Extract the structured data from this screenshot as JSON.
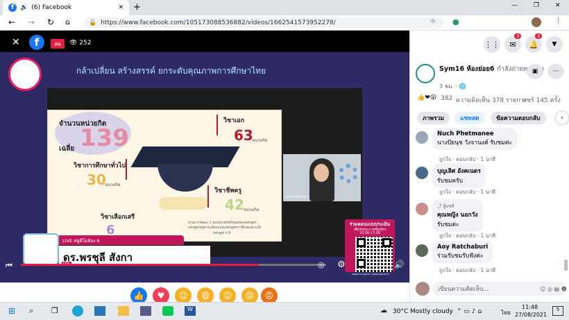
{
  "browser": {
    "tab_title": "(6) Facebook",
    "url": "https://www.facebook.com/105173088536882/videos/1662541573952278/"
  },
  "video": {
    "live_label": "สด",
    "viewer_count": "252",
    "headline": "กล้าเปลี่ยน สร้างสรรค์ ยกระดับคุณภาพการศึกษาไทย",
    "chart": {
      "total_title": "จำนวนหน่วยกิต",
      "avg_label": "เฉลี่ย",
      "total_value": "139",
      "segments": [
        {
          "label": "วิชาเอก",
          "value": "63",
          "unit": "หน่วยกิต"
        },
        {
          "label": "วิชาการศึกษาทั่วไป",
          "value": "30",
          "unit": "หน่วยกิต"
        },
        {
          "label": "วิชาชีพครู",
          "value": "42",
          "unit": "หน่วยกิต"
        },
        {
          "label": "วิชาเลือกเสรี",
          "value": "6",
          "unit": ""
        }
      ],
      "note_line1": "ส่วนมากร้อยละ 5 ของหน่วยกิตทั้งหมดของหลักสูตร",
      "note_line2": "หลักสูตรครูควรเปลี่ยนแปลงหลักสูตรการฝึกสอนตามได้",
      "note_line3": "หลักสูตร 4 ปี"
    },
    "webcam_caption": "ดร.พรชุลี สังกา",
    "lower_third": {
      "top_label": "LIVE สตูดิโอห้อง 6",
      "name": "ดร.พรชุลี สังกา",
      "badge": "LIVE"
    },
    "qr_panel": {
      "title": "ร่วมตอบแบบประเมิน",
      "subtitle": "เพื่อรับประกาศนียบัตร",
      "time": "10.00-17.00",
      "footer": "www.trcs.go.th / www.ksp.or.th"
    },
    "progress_fraction": 0.78
  },
  "post": {
    "page_name": "Sym16 ห้องย่อย6",
    "status": "กำลังถ่ายทอดสด",
    "time": "3 ชม.",
    "reactions_count": "382",
    "comments_count": "ความคิดเห็น 378 รายการ",
    "shares_count": "แชร์ 145 ครั้ง"
  },
  "tabs": [
    "ภาพรวม",
    "แชทสด",
    "ข้อความตอบกลับ"
  ],
  "comments": [
    {
      "name": "Nuch Phetmanee",
      "text": "นางปัยนุช วังจานงค์ รับชมค่ะ",
      "like": "ถูกใจ",
      "reply": "ตอบกลับ",
      "time": "1 นาที",
      "avatar_color": "#9aa7b8"
    },
    {
      "name": "บุญเลิศ อังคเนตร",
      "text": "รับชมครับ",
      "like": "ถูกใจ",
      "reply": "ตอบกลับ",
      "time": "1 นาที",
      "avatar_color": "#4a6a8a"
    },
    {
      "name": "คุณหญิง นอกวัง",
      "text": "รับชมค่ะ",
      "badge": "ผู้แชร์",
      "like": "ถูกใจ",
      "reply": "ตอบกลับ",
      "time": "1 นาที",
      "avatar_color": "#c88f8f"
    },
    {
      "name": "Aoy Ratchaburi",
      "text": "ร่วมรับชมรับฟังค่ะ",
      "like": "ถูกใจ",
      "reply": "ตอบกลับ",
      "time": "1 นาที",
      "avatar_color": "#5a6b5a"
    }
  ],
  "composer": {
    "placeholder": "เขียนความคิดเห็น..."
  },
  "taskbar": {
    "temperature": "30°C",
    "weather": "Mostly cloudy",
    "language": "ไทย",
    "time": "11:48",
    "date": "27/08/2021",
    "notification_count": "5"
  },
  "header_badges": {
    "messenger": "3",
    "notifications": "3"
  },
  "colors": {
    "live_red": "#e41e3f",
    "fb_blue": "#1877f2",
    "slide_bg": "#2e2a66",
    "pink": "#c2185b"
  }
}
